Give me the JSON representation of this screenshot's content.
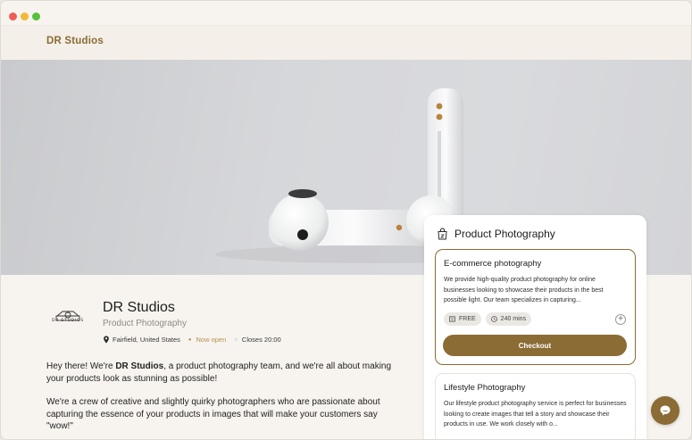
{
  "window": {
    "controls": [
      "close",
      "minimize",
      "maximize"
    ]
  },
  "header": {
    "brand": "DR Studios"
  },
  "hero": {
    "image": "white-earbuds-photo"
  },
  "profile": {
    "logo_text": "DR STUDIOS",
    "name": "DR Studios",
    "category": "Product Photography",
    "location": "Fairfield, United States",
    "status": "Now open",
    "closes": "Closes 20:00"
  },
  "description": {
    "p1_before": "Hey there! We're ",
    "p1_bold": "DR Studios",
    "p1_after": ", a product photography team, and we're all about making your products look as stunning as possible!",
    "p2": "We're a crew of creative and slightly quirky photographers who are passionate about capturing the essence of your products in images that will make your customers say \"wow!\""
  },
  "booking": {
    "title": "Product Photography",
    "services": [
      {
        "title": "E-commerce photography",
        "description": "We provide high-quality product photography for online businesses looking to showcase their products in the best possible light. Our team specializes in capturing...",
        "price": "FREE",
        "duration": "240 mins",
        "cta": "Checkout"
      },
      {
        "title": "Lifestyle Photography",
        "description": "Our lifestyle product photography service is perfect for businesses looking to create images that tell a story and showcase their products in use. We work closely with o..."
      }
    ]
  },
  "colors": {
    "accent": "#8a6c34",
    "status_open": "#b49150",
    "background": "#f7f4ef"
  }
}
